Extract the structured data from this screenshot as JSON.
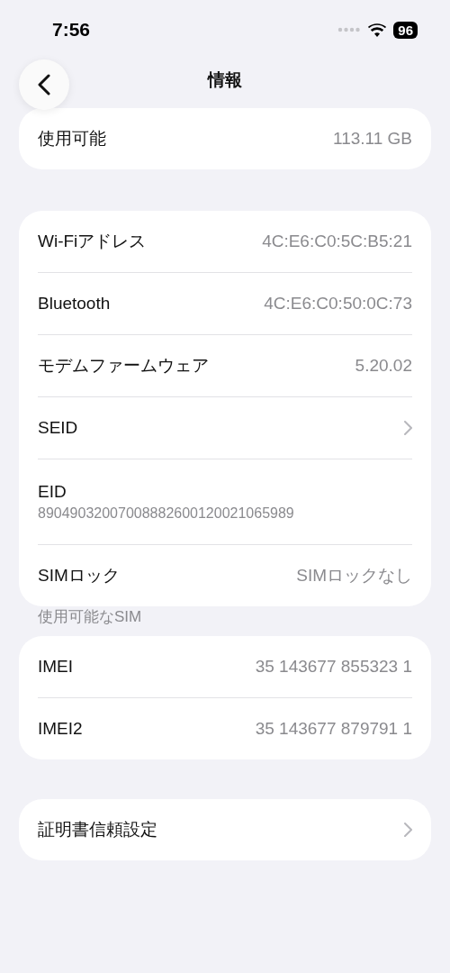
{
  "status_bar": {
    "time": "7:56",
    "battery": "96"
  },
  "nav": {
    "title": "情報"
  },
  "groups": [
    {
      "rows": [
        {
          "kind": "value",
          "label": "使用可能",
          "value": "113.11 GB"
        }
      ]
    },
    {
      "rows": [
        {
          "kind": "value",
          "label": "Wi-Fiアドレス",
          "value": "4C:E6:C0:5C:B5:21"
        },
        {
          "kind": "value",
          "label": "Bluetooth",
          "value": "4C:E6:C0:50:0C:73"
        },
        {
          "kind": "value",
          "label": "モデムファームウェア",
          "value": "5.20.02"
        },
        {
          "kind": "link",
          "label": "SEID"
        },
        {
          "kind": "stacked",
          "label": "EID",
          "value": "89049032007008882600120021065989"
        },
        {
          "kind": "value",
          "label": "SIMロック",
          "value": "SIMロックなし"
        }
      ]
    },
    {
      "header": "使用可能なSIM",
      "rows": [
        {
          "kind": "value",
          "label": "IMEI",
          "value": "35 143677 855323 1"
        },
        {
          "kind": "value",
          "label": "IMEI2",
          "value": "35 143677 879791 1"
        }
      ]
    },
    {
      "rows": [
        {
          "kind": "link",
          "label": "証明書信頼設定"
        }
      ]
    }
  ]
}
